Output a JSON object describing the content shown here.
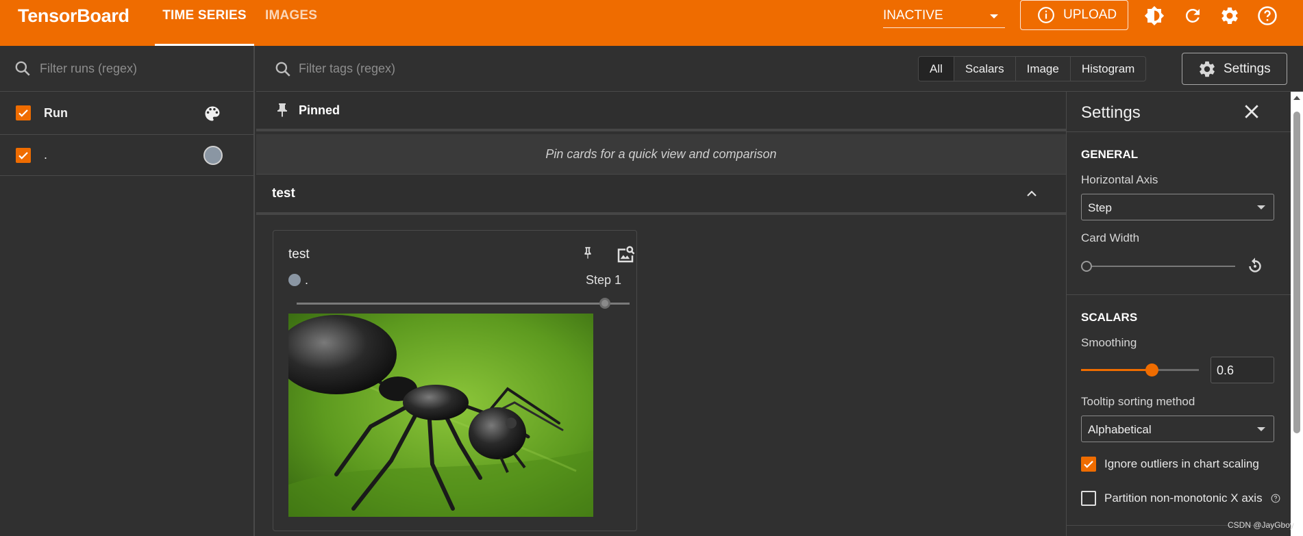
{
  "app": {
    "title": "TensorBoard"
  },
  "nav": {
    "tabs": [
      {
        "label": "TIME SERIES",
        "active": true
      },
      {
        "label": "IMAGES",
        "active": false
      }
    ]
  },
  "header": {
    "reload_value": "INACTIVE",
    "upload_label": "UPLOAD",
    "accent_color": "#ef6c00"
  },
  "runs": {
    "filter_placeholder": "Filter runs (regex)",
    "header_label": "Run",
    "items": [
      {
        "name": ".",
        "checked": true,
        "color": "#8a96a3"
      }
    ]
  },
  "toolbar": {
    "filter_placeholder": "Filter tags (regex)",
    "types": [
      "All",
      "Scalars",
      "Image",
      "Histogram"
    ],
    "active_type": "All",
    "settings_label": "Settings"
  },
  "main": {
    "pinned": {
      "title": "Pinned",
      "empty_text": "Pin cards for a quick view and comparison"
    },
    "group": {
      "title": "test"
    },
    "card": {
      "title": "test",
      "run_name": ".",
      "step_label": "Step 1"
    }
  },
  "settings": {
    "title": "Settings",
    "general": {
      "heading": "GENERAL",
      "horizontal_axis_label": "Horizontal Axis",
      "horizontal_axis_value": "Step",
      "card_width_label": "Card Width"
    },
    "scalars": {
      "heading": "SCALARS",
      "smoothing_label": "Smoothing",
      "smoothing_value": "0.6",
      "smoothing_fraction": 0.6,
      "tooltip_label": "Tooltip sorting method",
      "tooltip_value": "Alphabetical",
      "ignore_outliers_label": "Ignore outliers in chart scaling",
      "ignore_outliers_checked": true,
      "partition_label": "Partition non-monotonic X axis",
      "partition_checked": false
    }
  },
  "watermark": "CSDN @JayGboy"
}
